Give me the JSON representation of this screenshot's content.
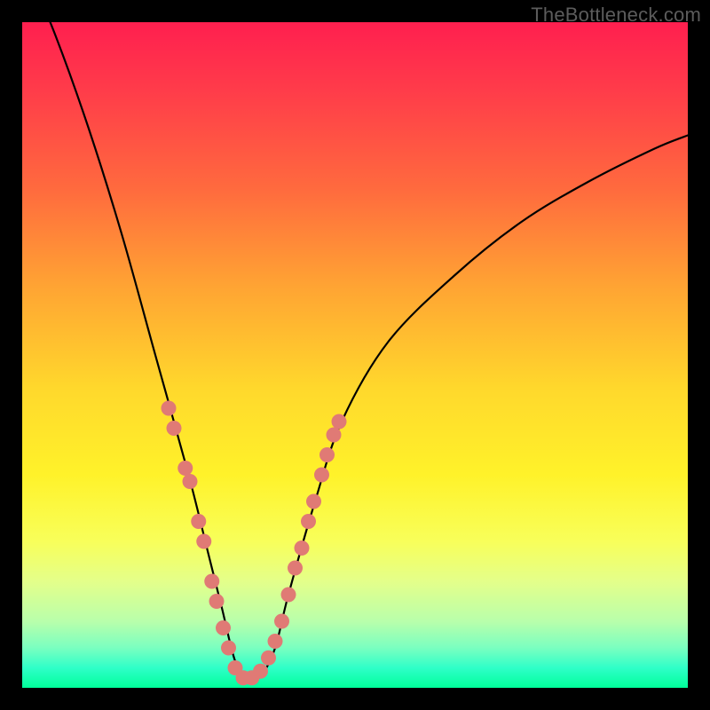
{
  "watermark": "TheBottleneck.com",
  "chart_data": {
    "type": "line",
    "title": "",
    "xlabel": "",
    "ylabel": "",
    "xlim": [
      0,
      100
    ],
    "ylim": [
      0,
      100
    ],
    "background_gradient": {
      "top": "#ff1f4f",
      "middle": "#ffd82c",
      "bottom": "#00ff9a"
    },
    "series": [
      {
        "name": "bottleneck-curve",
        "x": [
          0,
          5,
          10,
          15,
          20,
          25,
          28,
          30,
          32,
          34,
          36,
          38,
          40,
          44,
          48,
          55,
          65,
          75,
          85,
          95,
          100
        ],
        "y": [
          110,
          98,
          84,
          68,
          50,
          32,
          20,
          12,
          4,
          1,
          2,
          6,
          14,
          28,
          40,
          52,
          62,
          70,
          76,
          81,
          83
        ]
      }
    ],
    "highlight_dots": {
      "name": "highlighted-band",
      "points": [
        {
          "x": 22.0,
          "y": 42
        },
        {
          "x": 22.8,
          "y": 39
        },
        {
          "x": 24.5,
          "y": 33
        },
        {
          "x": 25.2,
          "y": 31
        },
        {
          "x": 26.5,
          "y": 25
        },
        {
          "x": 27.3,
          "y": 22
        },
        {
          "x": 28.5,
          "y": 16
        },
        {
          "x": 29.2,
          "y": 13
        },
        {
          "x": 30.2,
          "y": 9
        },
        {
          "x": 31.0,
          "y": 6
        },
        {
          "x": 32.0,
          "y": 3
        },
        {
          "x": 33.2,
          "y": 1.5
        },
        {
          "x": 34.5,
          "y": 1.5
        },
        {
          "x": 35.8,
          "y": 2.5
        },
        {
          "x": 37.0,
          "y": 4.5
        },
        {
          "x": 38.0,
          "y": 7
        },
        {
          "x": 39.0,
          "y": 10
        },
        {
          "x": 40.0,
          "y": 14
        },
        {
          "x": 41.0,
          "y": 18
        },
        {
          "x": 42.0,
          "y": 21
        },
        {
          "x": 43.0,
          "y": 25
        },
        {
          "x": 43.8,
          "y": 28
        },
        {
          "x": 45.0,
          "y": 32
        },
        {
          "x": 45.8,
          "y": 35
        },
        {
          "x": 46.8,
          "y": 38
        },
        {
          "x": 47.6,
          "y": 40
        }
      ]
    }
  }
}
